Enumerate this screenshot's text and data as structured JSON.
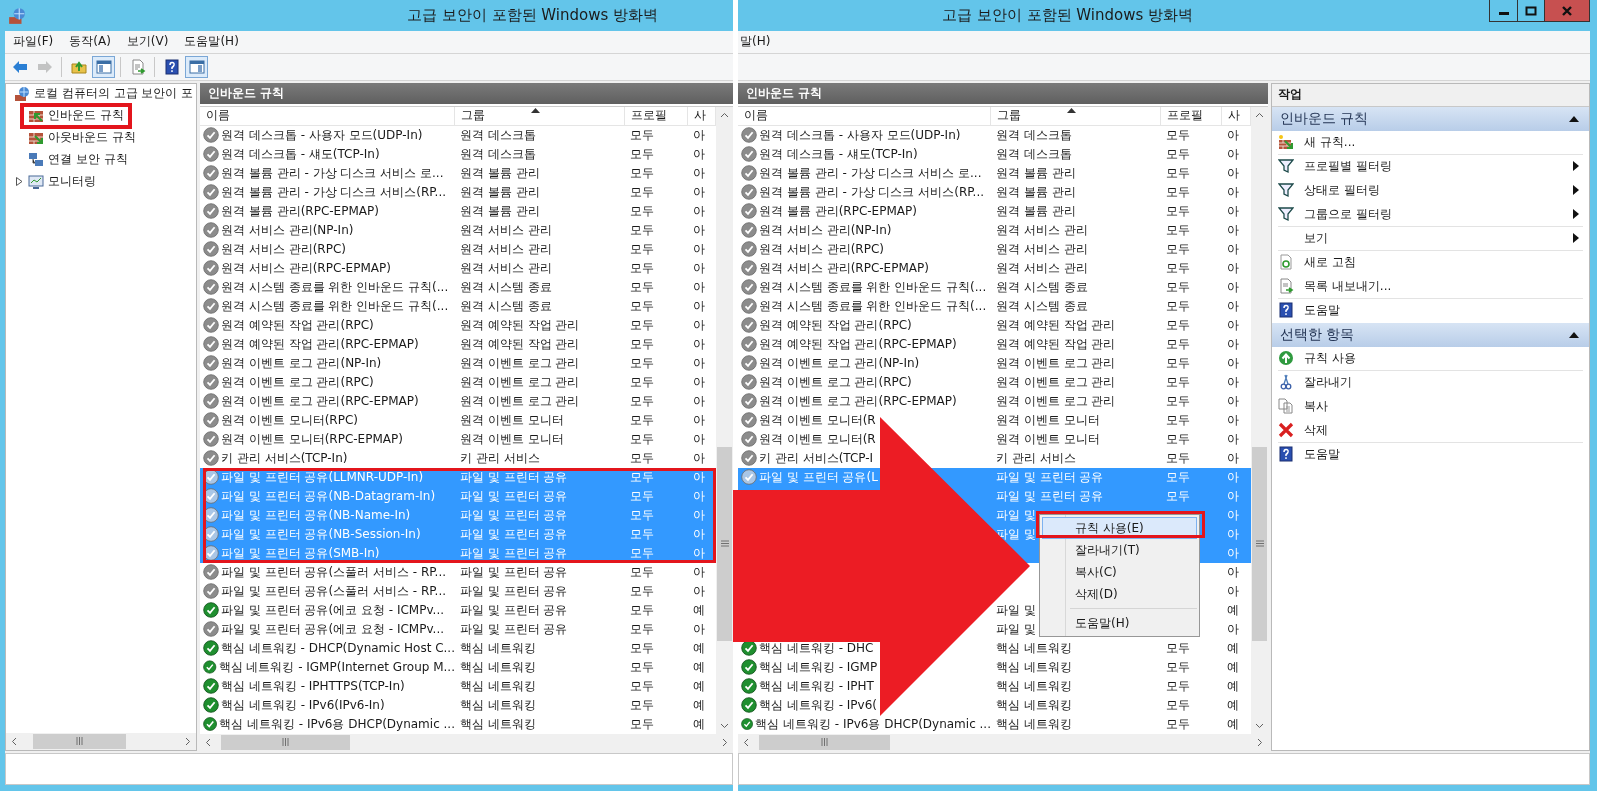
{
  "left_window": {
    "title": "고급 보안이 포함된 Windows 방화벽",
    "menu": [
      {
        "label": "파일(F)"
      },
      {
        "label": "동작(A)"
      },
      {
        "label": "보기(V)"
      },
      {
        "label": "도움말(H)"
      }
    ],
    "toolbar": [
      {
        "kind": "back",
        "disabled": false,
        "pressed": false
      },
      {
        "kind": "forward",
        "disabled": true,
        "pressed": false
      },
      {
        "kind": "separator"
      },
      {
        "kind": "up",
        "disabled": false,
        "pressed": false
      },
      {
        "kind": "console_tree",
        "disabled": false,
        "pressed": true
      },
      {
        "kind": "separator"
      },
      {
        "kind": "export",
        "disabled": false,
        "pressed": false
      },
      {
        "kind": "separator"
      },
      {
        "kind": "help",
        "disabled": false,
        "pressed": false
      },
      {
        "kind": "action_pane",
        "disabled": false,
        "pressed": true
      }
    ],
    "tree": {
      "label": "로컬 컴퓨터의 고급 보안이 포",
      "kind": "root",
      "expandable": false,
      "annotated": false,
      "children": [
        {
          "label": "인바운드 규칙",
          "kind": "inbound",
          "expandable": false,
          "annotated": true
        },
        {
          "label": "아웃바운드 규칙",
          "kind": "outbound",
          "expandable": false,
          "annotated": false
        },
        {
          "label": "연결 보안 규칙",
          "kind": "connection",
          "expandable": false,
          "annotated": false
        },
        {
          "label": "모니터링",
          "kind": "monitoring",
          "expandable": true,
          "annotated": false
        }
      ]
    },
    "list": {
      "heading": "인바운드 규칙",
      "selection_boxed": true,
      "columns": [
        {
          "label": "이름",
          "sorted": false
        },
        {
          "label": "그룹",
          "sorted": true
        },
        {
          "label": "프로필",
          "sorted": false
        },
        {
          "label": "사",
          "sorted": false
        }
      ],
      "rows": [
        {
          "name": "원격 데스크톱 - 사용자 모드(UDP-In)",
          "group": "원격 데스크톱",
          "profile": "모두",
          "use": "아",
          "enabled": false,
          "selected": false
        },
        {
          "name": "원격 데스크톱 - 섀도(TCP-In)",
          "group": "원격 데스크톱",
          "profile": "모두",
          "use": "아",
          "enabled": false,
          "selected": false
        },
        {
          "name": "원격 볼륨 관리 - 가상 디스크 서비스 로...",
          "group": "원격 볼륨 관리",
          "profile": "모두",
          "use": "아",
          "enabled": false,
          "selected": false
        },
        {
          "name": "원격 볼륨 관리 - 가상 디스크 서비스(RP...",
          "group": "원격 볼륨 관리",
          "profile": "모두",
          "use": "아",
          "enabled": false,
          "selected": false
        },
        {
          "name": "원격 볼륨 관리(RPC-EPMAP)",
          "group": "원격 볼륨 관리",
          "profile": "모두",
          "use": "아",
          "enabled": false,
          "selected": false
        },
        {
          "name": "원격 서비스 관리(NP-In)",
          "group": "원격 서비스 관리",
          "profile": "모두",
          "use": "아",
          "enabled": false,
          "selected": false
        },
        {
          "name": "원격 서비스 관리(RPC)",
          "group": "원격 서비스 관리",
          "profile": "모두",
          "use": "아",
          "enabled": false,
          "selected": false
        },
        {
          "name": "원격 서비스 관리(RPC-EPMAP)",
          "group": "원격 서비스 관리",
          "profile": "모두",
          "use": "아",
          "enabled": false,
          "selected": false
        },
        {
          "name": "원격 시스템 종료를 위한 인바운드 규칙(...",
          "group": "원격 시스템 종료",
          "profile": "모두",
          "use": "아",
          "enabled": false,
          "selected": false
        },
        {
          "name": "원격 시스템 종료를 위한 인바운드 규칙(...",
          "group": "원격 시스템 종료",
          "profile": "모두",
          "use": "아",
          "enabled": false,
          "selected": false
        },
        {
          "name": "원격 예약된 작업 관리(RPC)",
          "group": "원격 예약된 작업 관리",
          "profile": "모두",
          "use": "아",
          "enabled": false,
          "selected": false
        },
        {
          "name": "원격 예약된 작업 관리(RPC-EPMAP)",
          "group": "원격 예약된 작업 관리",
          "profile": "모두",
          "use": "아",
          "enabled": false,
          "selected": false
        },
        {
          "name": "원격 이벤트 로그 관리(NP-In)",
          "group": "원격 이벤트 로그 관리",
          "profile": "모두",
          "use": "아",
          "enabled": false,
          "selected": false
        },
        {
          "name": "원격 이벤트 로그 관리(RPC)",
          "group": "원격 이벤트 로그 관리",
          "profile": "모두",
          "use": "아",
          "enabled": false,
          "selected": false
        },
        {
          "name": "원격 이벤트 로그 관리(RPC-EPMAP)",
          "group": "원격 이벤트 로그 관리",
          "profile": "모두",
          "use": "아",
          "enabled": false,
          "selected": false
        },
        {
          "name": "원격 이벤트 모니터(RPC)",
          "group": "원격 이벤트 모니터",
          "profile": "모두",
          "use": "아",
          "enabled": false,
          "selected": false
        },
        {
          "name": "원격 이벤트 모니터(RPC-EPMAP)",
          "group": "원격 이벤트 모니터",
          "profile": "모두",
          "use": "아",
          "enabled": false,
          "selected": false
        },
        {
          "name": "키 관리 서비스(TCP-In)",
          "group": "키 관리 서비스",
          "profile": "모두",
          "use": "아",
          "enabled": false,
          "selected": false
        },
        {
          "name": "파일 및 프린터 공유(LLMNR-UDP-In)",
          "group": "파일 및 프린터 공유",
          "profile": "모두",
          "use": "아",
          "enabled": false,
          "selected": true
        },
        {
          "name": "파일 및 프린터 공유(NB-Datagram-In)",
          "group": "파일 및 프린터 공유",
          "profile": "모두",
          "use": "아",
          "enabled": false,
          "selected": true
        },
        {
          "name": "파일 및 프린터 공유(NB-Name-In)",
          "group": "파일 및 프린터 공유",
          "profile": "모두",
          "use": "아",
          "enabled": false,
          "selected": true
        },
        {
          "name": "파일 및 프린터 공유(NB-Session-In)",
          "group": "파일 및 프린터 공유",
          "profile": "모두",
          "use": "아",
          "enabled": false,
          "selected": true
        },
        {
          "name": "파일 및 프린터 공유(SMB-In)",
          "group": "파일 및 프린터 공유",
          "profile": "모두",
          "use": "아",
          "enabled": false,
          "selected": true
        },
        {
          "name": "파일 및 프린터 공유(스풀러 서비스 - RP...",
          "group": "파일 및 프린터 공유",
          "profile": "모두",
          "use": "아",
          "enabled": false,
          "selected": false
        },
        {
          "name": "파일 및 프린터 공유(스풀러 서비스 - RP...",
          "group": "파일 및 프린터 공유",
          "profile": "모두",
          "use": "아",
          "enabled": false,
          "selected": false
        },
        {
          "name": "파일 및 프린터 공유(에코 요청 - ICMPv...",
          "group": "파일 및 프린터 공유",
          "profile": "모두",
          "use": "예",
          "enabled": true,
          "selected": false
        },
        {
          "name": "파일 및 프린터 공유(에코 요청 - ICMPv...",
          "group": "파일 및 프린터 공유",
          "profile": "모두",
          "use": "아",
          "enabled": false,
          "selected": false
        },
        {
          "name": "핵심 네트워킹 - DHCP(Dynamic Host C...",
          "group": "핵심 네트워킹",
          "profile": "모두",
          "use": "예",
          "enabled": true,
          "selected": false
        },
        {
          "name": "핵심 네트워킹 - IGMP(Internet Group M...",
          "group": "핵심 네트워킹",
          "profile": "모두",
          "use": "예",
          "enabled": true,
          "selected": false
        },
        {
          "name": "핵심 네트워킹 - IPHTTPS(TCP-In)",
          "group": "핵심 네트워킹",
          "profile": "모두",
          "use": "예",
          "enabled": true,
          "selected": false
        },
        {
          "name": "핵심 네트워킹 - IPv6(IPv6-In)",
          "group": "핵심 네트워킹",
          "profile": "모두",
          "use": "예",
          "enabled": true,
          "selected": false
        },
        {
          "name": "핵심 네트워킹 - IPv6용 DHCP(Dynamic ...",
          "group": "핵심 네트워킹",
          "profile": "모두",
          "use": "예",
          "enabled": true,
          "selected": false
        }
      ]
    }
  },
  "right_window": {
    "title": "고급 보안이 포함된 Windows 방화벽",
    "menu": [
      {
        "label": "말(H)"
      }
    ],
    "list": {
      "heading": "인바운드 규칙",
      "columns": [
        {
          "label": "이름",
          "sorted": false
        },
        {
          "label": "그룹",
          "sorted": true
        },
        {
          "label": "프로필",
          "sorted": false
        },
        {
          "label": "사",
          "sorted": false
        }
      ],
      "rows": [
        {
          "name": "원격 데스크톱 - 사용자 모드(UDP-In)",
          "group": "원격 데스크톱",
          "profile": "모두",
          "use": "아",
          "enabled": false,
          "selected": false
        },
        {
          "name": "원격 데스크톱 - 섀도(TCP-In)",
          "group": "원격 데스크톱",
          "profile": "모두",
          "use": "아",
          "enabled": false,
          "selected": false
        },
        {
          "name": "원격 볼륨 관리 - 가상 디스크 서비스 로...",
          "group": "원격 볼륨 관리",
          "profile": "모두",
          "use": "아",
          "enabled": false,
          "selected": false
        },
        {
          "name": "원격 볼륨 관리 - 가상 디스크 서비스(RP...",
          "group": "원격 볼륨 관리",
          "profile": "모두",
          "use": "아",
          "enabled": false,
          "selected": false
        },
        {
          "name": "원격 볼륨 관리(RPC-EPMAP)",
          "group": "원격 볼륨 관리",
          "profile": "모두",
          "use": "아",
          "enabled": false,
          "selected": false
        },
        {
          "name": "원격 서비스 관리(NP-In)",
          "group": "원격 서비스 관리",
          "profile": "모두",
          "use": "아",
          "enabled": false,
          "selected": false
        },
        {
          "name": "원격 서비스 관리(RPC)",
          "group": "원격 서비스 관리",
          "profile": "모두",
          "use": "아",
          "enabled": false,
          "selected": false
        },
        {
          "name": "원격 서비스 관리(RPC-EPMAP)",
          "group": "원격 서비스 관리",
          "profile": "모두",
          "use": "아",
          "enabled": false,
          "selected": false
        },
        {
          "name": "원격 시스템 종료를 위한 인바운드 규칙(...",
          "group": "원격 시스템 종료",
          "profile": "모두",
          "use": "아",
          "enabled": false,
          "selected": false
        },
        {
          "name": "원격 시스템 종료를 위한 인바운드 규칙(...",
          "group": "원격 시스템 종료",
          "profile": "모두",
          "use": "아",
          "enabled": false,
          "selected": false
        },
        {
          "name": "원격 예약된 작업 관리(RPC)",
          "group": "원격 예약된 작업 관리",
          "profile": "모두",
          "use": "아",
          "enabled": false,
          "selected": false
        },
        {
          "name": "원격 예약된 작업 관리(RPC-EPMAP)",
          "group": "원격 예약된 작업 관리",
          "profile": "모두",
          "use": "아",
          "enabled": false,
          "selected": false
        },
        {
          "name": "원격 이벤트 로그 관리(NP-In)",
          "group": "원격 이벤트 로그 관리",
          "profile": "모두",
          "use": "아",
          "enabled": false,
          "selected": false
        },
        {
          "name": "원격 이벤트 로그 관리(RPC)",
          "group": "원격 이벤트 로그 관리",
          "profile": "모두",
          "use": "아",
          "enabled": false,
          "selected": false
        },
        {
          "name": "원격 이벤트 로그 관리(RPC-EPMAP)",
          "group": "원격 이벤트 로그 관리",
          "profile": "모두",
          "use": "아",
          "enabled": false,
          "selected": false
        },
        {
          "name": "원격 이벤트 모니터(R",
          "group": "원격 이벤트 모니터",
          "profile": "모두",
          "use": "아",
          "enabled": false,
          "selected": false
        },
        {
          "name": "원격 이벤트 모니터(R",
          "group": "원격 이벤트 모니터",
          "profile": "모두",
          "use": "아",
          "enabled": false,
          "selected": false
        },
        {
          "name": "키 관리 서비스(TCP-I",
          "group": "키 관리 서비스",
          "profile": "모두",
          "use": "아",
          "enabled": false,
          "selected": false
        },
        {
          "name": "파일 및 프린터 공유(L",
          "group": "파일 및 프린터 공유",
          "profile": "모두",
          "use": "아",
          "enabled": false,
          "selected": true
        },
        {
          "group": "파일 및 프린터 공유",
          "profile": "모두",
          "use": "아",
          "selected": true
        },
        {
          "group": "파일 및",
          "use": "아",
          "selected": true
        },
        {
          "group": "파일 및",
          "use": "아",
          "selected": true
        },
        {
          "use": "아",
          "selected": true
        },
        {
          "use": "아",
          "selected": false
        },
        {
          "use": "아",
          "selected": false
        },
        {
          "group": "파일 및",
          "use": "예",
          "selected": false
        },
        {
          "group": "파일 및",
          "use": "아",
          "selected": false
        },
        {
          "name": "핵심 네트워킹 - DHC",
          "group": "핵심 네트워킹",
          "profile": "모두",
          "use": "예",
          "enabled": true,
          "selected": false
        },
        {
          "name": "핵심 네트워킹 - IGMP",
          "group": "핵심 네트워킹",
          "profile": "모두",
          "use": "예",
          "enabled": true,
          "selected": false
        },
        {
          "name": "핵심 네트워킹 - IPHT",
          "group": "핵심 네트워킹",
          "profile": "모두",
          "use": "예",
          "enabled": true,
          "selected": false
        },
        {
          "name": "핵심 네트워킹 - IPv6(",
          "group": "핵심 네트워킹",
          "profile": "모두",
          "use": "예",
          "enabled": true,
          "selected": false
        },
        {
          "name": "핵심 네트워킹 - IPv6용 DHCP(Dynamic ...",
          "group": "핵심 네트워킹",
          "profile": "모두",
          "use": "예",
          "enabled": true,
          "selected": false
        }
      ]
    },
    "actions": {
      "header": "작업",
      "sections": [
        {
          "title": "인바운드 규칙",
          "expanded": true,
          "items": [
            {
              "label": "새 규칙...",
              "kind": "new_rule",
              "submenu": false,
              "divider_after": true
            },
            {
              "label": "프로필별 필터링",
              "kind": "filter",
              "submenu": true,
              "divider_after": false
            },
            {
              "label": "상태로 필터링",
              "kind": "filter",
              "submenu": true,
              "divider_after": false
            },
            {
              "label": "그룹으로 필터링",
              "kind": "filter",
              "submenu": true,
              "divider_after": true
            },
            {
              "label": "보기",
              "kind": "plain",
              "submenu": true,
              "divider_after": true
            },
            {
              "label": "새로 고침",
              "kind": "refresh",
              "submenu": false,
              "divider_after": false
            },
            {
              "label": "목록 내보내기...",
              "kind": "export",
              "submenu": false,
              "divider_after": true
            },
            {
              "label": "도움말",
              "kind": "help",
              "submenu": false,
              "divider_after": false
            }
          ]
        },
        {
          "title": "선택한 항목",
          "expanded": true,
          "items": [
            {
              "label": "규칙 사용",
              "kind": "enable",
              "submenu": false,
              "divider_after": true
            },
            {
              "label": "잘라내기",
              "kind": "cut",
              "submenu": false,
              "divider_after": false
            },
            {
              "label": "복사",
              "kind": "copy",
              "submenu": false,
              "divider_after": false
            },
            {
              "label": "삭제",
              "kind": "delete",
              "submenu": false,
              "divider_after": true
            },
            {
              "label": "도움말",
              "kind": "help",
              "submenu": false,
              "divider_after": false
            }
          ]
        }
      ]
    },
    "context_menu": {
      "items": [
        {
          "kind": "item",
          "label": "규칙 사용(E)",
          "selected": true,
          "annotated": true
        },
        {
          "kind": "item",
          "label": "잘라내기(T)",
          "selected": false,
          "annotated": false
        },
        {
          "kind": "item",
          "label": "복사(C)",
          "selected": false,
          "annotated": false
        },
        {
          "kind": "item",
          "label": "삭제(D)",
          "selected": false,
          "annotated": false
        },
        {
          "kind": "separator"
        },
        {
          "kind": "item",
          "label": "도움말(H)",
          "selected": false,
          "annotated": false
        }
      ]
    }
  },
  "arrow": true
}
